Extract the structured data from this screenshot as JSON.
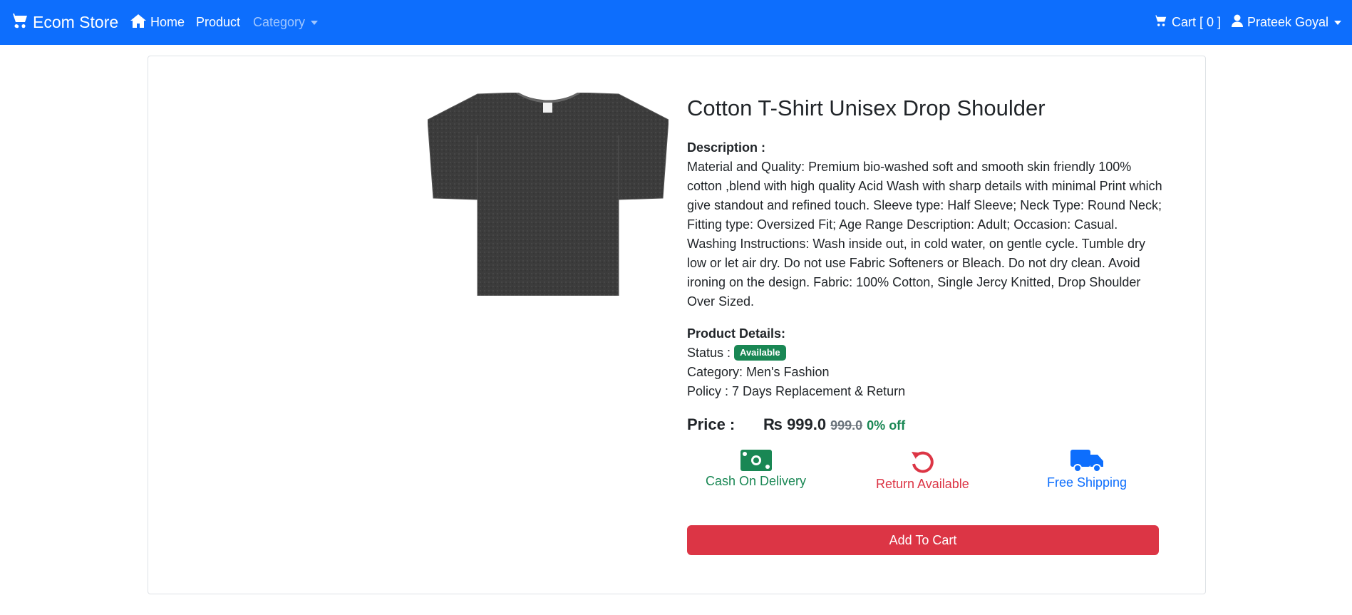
{
  "navbar": {
    "brand": "Ecom Store",
    "links": {
      "home": "Home",
      "product": "Product",
      "category": "Category"
    },
    "cart_label": "Cart [ 0 ]",
    "user_name": "Prateek Goyal",
    "bg_color": "#0d6efd"
  },
  "product": {
    "title": "Cotton T-Shirt Unisex Drop Shoulder",
    "description_label": "Description :",
    "description": "Material and Quality: Premium bio-washed soft and smooth skin friendly 100% cotton ,blend with high quality Acid Wash with sharp details with minimal Print which give standout and refined touch. Sleeve type: Half Sleeve; Neck Type: Round Neck; Fitting type: Oversized Fit; Age Range Description: Adult; Occasion: Casual. Washing Instructions: Wash inside out, in cold water, on gentle cycle. Tumble dry low or let air dry. Do not use Fabric Softeners or Bleach. Do not dry clean. Avoid ironing on the design. Fabric: 100% Cotton, Single Jercy Knitted, Drop Shoulder Over Sized.",
    "details_label": "Product Details:",
    "status_label": "Status :",
    "status_badge": "Available",
    "category_line": "Category: Men's Fashion",
    "policy_line": "Policy : 7 Days Replacement & Return",
    "price_label": "Price :",
    "price_current": "₨ 999.0",
    "price_original": "999.0",
    "discount": "0% off",
    "features": {
      "cod": "Cash On Delivery",
      "return": "Return Available",
      "shipping": "Free Shipping"
    },
    "add_to_cart": "Add To Cart"
  },
  "colors": {
    "primary": "#0d6efd",
    "success": "#198754",
    "danger": "#dc3545"
  },
  "icons": [
    "cart-icon",
    "home-icon",
    "user-icon",
    "money-icon",
    "return-icon",
    "truck-icon"
  ]
}
